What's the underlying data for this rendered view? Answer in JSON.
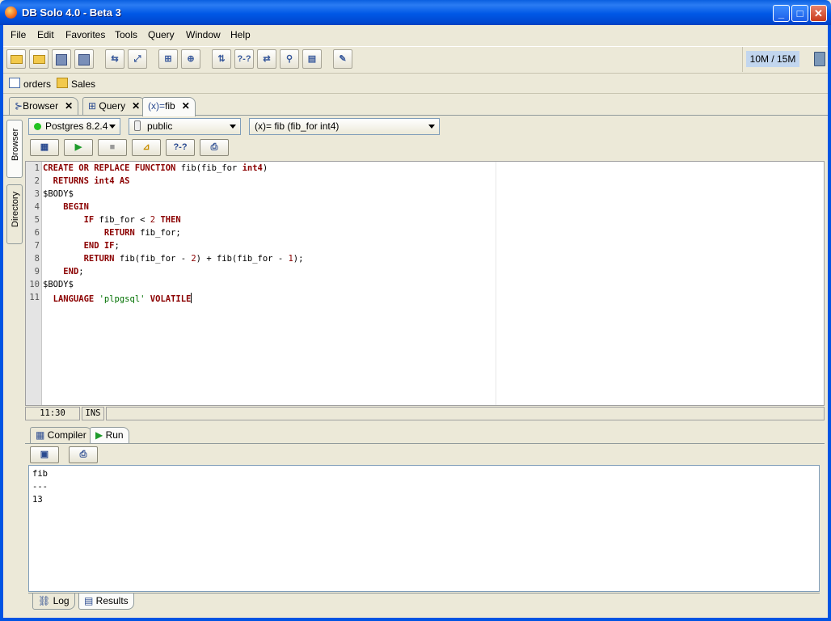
{
  "window": {
    "title": "DB Solo  4.0 - Beta 3",
    "min": "_",
    "max": "□",
    "close": "✕"
  },
  "menu": [
    "File",
    "Edit",
    "Favorites",
    "Tools",
    "Query",
    "Window",
    "Help"
  ],
  "toolbar": {
    "buttons": [
      "open-folder",
      "open-db",
      "save",
      "save-all",
      "connect",
      "disconnect",
      "browser",
      "query",
      "compare",
      "help-query",
      "migrate",
      "search",
      "report",
      "edit"
    ],
    "help_glyph": "?-?",
    "memory": "10M / 15M"
  },
  "bookmarks": [
    {
      "icon": "table-icon",
      "label": "orders"
    },
    {
      "icon": "folder-icon",
      "label": "Sales"
    }
  ],
  "main_tabs": [
    {
      "label": "Browser",
      "close": "✕"
    },
    {
      "label": "Query",
      "close": "✕"
    },
    {
      "label": "fib",
      "prefix": "(x)=",
      "close": "✕"
    }
  ],
  "side_tabs": [
    "Browser",
    "Directory"
  ],
  "selectors": {
    "server": "Postgres 8.2.4",
    "schema": "public",
    "function": "(x)= fib (fib_for int4)"
  },
  "editor": {
    "lines": [
      {
        "n": "1"
      },
      {
        "n": "2"
      },
      {
        "n": "3"
      },
      {
        "n": "4"
      },
      {
        "n": "5"
      },
      {
        "n": "6"
      },
      {
        "n": "7"
      },
      {
        "n": "8"
      },
      {
        "n": "9"
      },
      {
        "n": "10"
      },
      {
        "n": "11"
      }
    ],
    "status": {
      "position": "11:30",
      "mode": "INS"
    }
  },
  "bottom_tabs": [
    {
      "label": "Compiler"
    },
    {
      "label": "Run"
    }
  ],
  "output": [
    "fib",
    "---",
    "13"
  ],
  "result_tabs": [
    {
      "label": "Log"
    },
    {
      "label": "Results"
    }
  ],
  "colors": {
    "keyword": "#8b0000",
    "string": "#007000",
    "titlebar": "#0058e6"
  }
}
